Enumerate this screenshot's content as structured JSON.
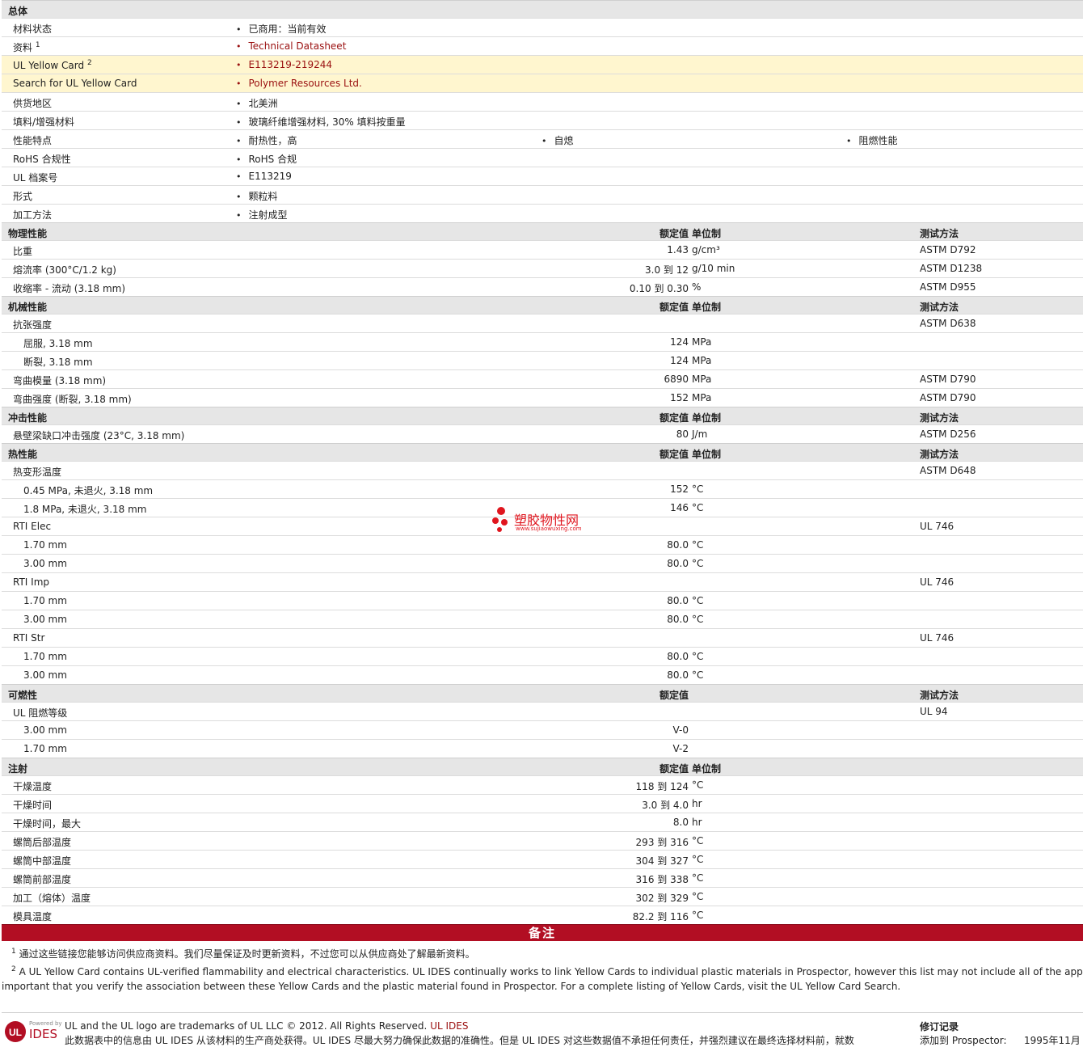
{
  "general": {
    "title": "总体",
    "rows": [
      {
        "label": "材料状态",
        "values": [
          "已商用：当前有效"
        ]
      },
      {
        "label": "资料",
        "sup": "1",
        "values": [
          "Technical Datasheet"
        ],
        "link": true
      },
      {
        "label": "UL Yellow Card",
        "sup": "2",
        "values": [
          "E113219-219244"
        ],
        "link": true,
        "highlight": true
      },
      {
        "label": "Search for UL Yellow Card",
        "values": [
          "Polymer Resources Ltd."
        ],
        "link": true,
        "highlight": true
      },
      {
        "label": "供货地区",
        "values": [
          "北美洲"
        ]
      },
      {
        "label": "填料/增强材料",
        "values": [
          "玻璃纤维增强材料, 30% 填料按重量"
        ]
      },
      {
        "label": "性能特点",
        "values": [
          "耐热性，高",
          "自熄",
          "阻燃性能"
        ]
      },
      {
        "label": "RoHS 合规性",
        "values": [
          "RoHS 合规"
        ]
      },
      {
        "label": "UL 档案号",
        "values": [
          "E113219"
        ]
      },
      {
        "label": "形式",
        "values": [
          "颗粒料"
        ]
      },
      {
        "label": "加工方法",
        "values": [
          "注射成型"
        ]
      }
    ]
  },
  "headers": {
    "nominal": "额定值",
    "unit": "单位制",
    "method": "测试方法"
  },
  "sections": [
    {
      "title": "物理性能",
      "show_unit": true,
      "show_method": true,
      "rows": [
        {
          "label": "比重",
          "nominal": "1.43",
          "unit": "g/cm³",
          "method": "ASTM D792"
        },
        {
          "label": "熔流率 (300°C/1.2 kg)",
          "nominal": "3.0 到 12",
          "unit": "g/10 min",
          "method": "ASTM D1238"
        },
        {
          "label": "收缩率 - 流动 (3.18 mm)",
          "nominal": "0.10 到 0.30",
          "unit": "%",
          "method": "ASTM D955"
        }
      ]
    },
    {
      "title": "机械性能",
      "show_unit": true,
      "show_method": true,
      "rows": [
        {
          "label": "抗张强度",
          "method": "ASTM D638"
        },
        {
          "label": "屈服, 3.18 mm",
          "indent": true,
          "nominal": "124",
          "unit": "MPa"
        },
        {
          "label": "断裂, 3.18 mm",
          "indent": true,
          "nominal": "124",
          "unit": "MPa"
        },
        {
          "label": "弯曲模量 (3.18 mm)",
          "nominal": "6890",
          "unit": "MPa",
          "method": "ASTM D790"
        },
        {
          "label": "弯曲强度 (断裂, 3.18 mm)",
          "nominal": "152",
          "unit": "MPa",
          "method": "ASTM D790"
        }
      ]
    },
    {
      "title": "冲击性能",
      "show_unit": true,
      "show_method": true,
      "rows": [
        {
          "label": "悬壁梁缺口冲击强度 (23°C, 3.18 mm)",
          "nominal": "80",
          "unit": "J/m",
          "method": "ASTM D256"
        }
      ]
    },
    {
      "title": "热性能",
      "show_unit": true,
      "show_method": true,
      "rows": [
        {
          "label": "热变形温度",
          "method": "ASTM D648"
        },
        {
          "label": "0.45 MPa, 未退火, 3.18 mm",
          "indent": true,
          "nominal": "152",
          "unit": "°C"
        },
        {
          "label": "1.8 MPa, 未退火, 3.18 mm",
          "indent": true,
          "nominal": "146",
          "unit": "°C"
        },
        {
          "label": "RTI Elec",
          "method": "UL 746"
        },
        {
          "label": "1.70 mm",
          "indent": true,
          "nominal": "80.0",
          "unit": "°C"
        },
        {
          "label": "3.00 mm",
          "indent": true,
          "nominal": "80.0",
          "unit": "°C"
        },
        {
          "label": "RTI Imp",
          "method": "UL 746"
        },
        {
          "label": "1.70 mm",
          "indent": true,
          "nominal": "80.0",
          "unit": "°C"
        },
        {
          "label": "3.00 mm",
          "indent": true,
          "nominal": "80.0",
          "unit": "°C"
        },
        {
          "label": "RTI Str",
          "method": "UL 746"
        },
        {
          "label": "1.70 mm",
          "indent": true,
          "nominal": "80.0",
          "unit": "°C"
        },
        {
          "label": "3.00 mm",
          "indent": true,
          "nominal": "80.0",
          "unit": "°C"
        }
      ]
    },
    {
      "title": "可燃性",
      "show_unit": false,
      "show_method": true,
      "rows": [
        {
          "label": "UL 阻燃等级",
          "method": "UL 94"
        },
        {
          "label": "3.00 mm",
          "indent": true,
          "nominal": "V-0"
        },
        {
          "label": "1.70 mm",
          "indent": true,
          "nominal": "V-2"
        }
      ]
    },
    {
      "title": "注射",
      "show_unit": true,
      "show_method": false,
      "rows": [
        {
          "label": "干燥温度",
          "nominal": "118 到 124",
          "unit": "°C"
        },
        {
          "label": "干燥时间",
          "nominal": "3.0 到 4.0",
          "unit": "hr"
        },
        {
          "label": "干燥时间，最大",
          "nominal": "8.0",
          "unit": "hr"
        },
        {
          "label": "螺筒后部温度",
          "nominal": "293 到 316",
          "unit": "°C"
        },
        {
          "label": "螺筒中部温度",
          "nominal": "304 到 327",
          "unit": "°C"
        },
        {
          "label": "螺筒前部温度",
          "nominal": "316 到 338",
          "unit": "°C"
        },
        {
          "label": "加工（熔体）温度",
          "nominal": "302 到 329",
          "unit": "°C"
        },
        {
          "label": "模具温度",
          "nominal": "82.2 到 116",
          "unit": "°C"
        }
      ]
    }
  ],
  "notes": {
    "title": "备注",
    "items": [
      {
        "sup": "1",
        "text": "通过这些链接您能够访问供应商资料。我们尽量保证及时更新资料，不过您可以从供应商处了解最新资料。"
      },
      {
        "sup": "2",
        "text": "A UL Yellow Card contains UL-verified flammability and electrical characteristics. UL IDES continually works to link Yellow Cards to individual plastic materials in Prospector, however this list may not include all of the appropriate",
        "text2": "important that you verify the association between these Yellow Cards and the plastic material found in Prospector. For a complete listing of Yellow Cards, visit the UL Yellow Card Search."
      }
    ]
  },
  "footer": {
    "logo_small": "Powered by",
    "logo_text": "IDES",
    "trademark": "UL and the UL logo are trademarks of UL LLC © 2012. All Rights Reserved.",
    "trademark_link": "UL IDES",
    "disclaimer": "此数据表中的信息由 UL IDES 从该材料的生产商处获得。UL IDES 尽最大努力确保此数据的准确性。但是 UL IDES 对这些数据值不承担任何责任，并强烈建议在最终选择材料前，就数",
    "revision_title": "修订记录",
    "revision_label": "添加到 Prospector:",
    "revision_value": "1995年11月"
  },
  "watermark": {
    "text": "塑胶物性网",
    "url": "www.sujiaowuxing.com"
  }
}
